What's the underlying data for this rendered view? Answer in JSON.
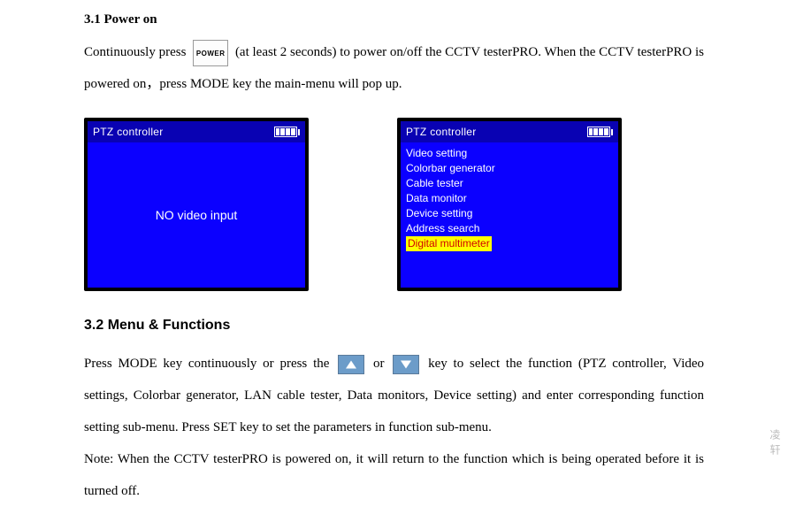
{
  "section1": {
    "heading": "3.1 Power on",
    "p1a": "Continuously press ",
    "power_label": "POWER",
    "p1b": " (at least 2 seconds) to power on/off the CCTV testerPRO. When the CCTV testerPRO is powered on，press MODE key the main-menu will pop up."
  },
  "lcd1": {
    "title": "PTZ controller",
    "body": "NO video input"
  },
  "lcd2": {
    "title": "PTZ controller",
    "items": [
      "Video setting",
      "Colorbar generator",
      "Cable tester",
      "Data monitor",
      "Device setting",
      "Address search"
    ],
    "selected": "Digital multimeter"
  },
  "section2": {
    "heading": "3.2 Menu & Functions",
    "p1a": "Press MODE key continuously or press the ",
    "or": " or ",
    "p1b": " key to select the function (PTZ controller, Video settings, Colorbar generator, LAN cable tester, Data monitors, Device setting) and enter corresponding function setting sub-menu. Press SET key to set the parameters in function sub-menu.",
    "note": "Note: When the CCTV testerPRO is powered on, it will return to the function which is being operated before it is turned off."
  },
  "side": "凌 轩"
}
